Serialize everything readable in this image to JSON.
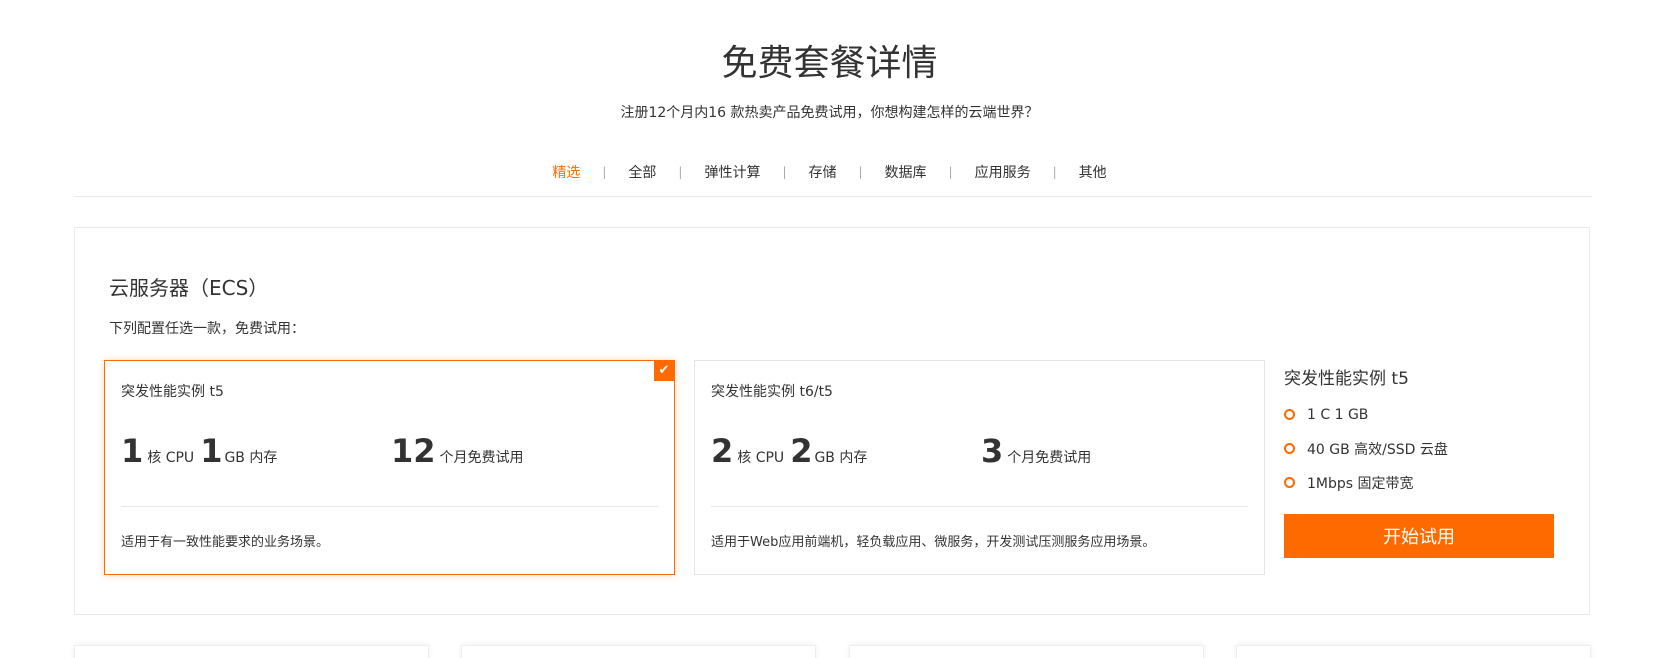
{
  "header": {
    "title": "免费套餐详情",
    "subtitle": "注册12个月内16 款热卖产品免费试用，你想构建怎样的云端世界？"
  },
  "tabs": [
    {
      "label": "精选",
      "active": true
    },
    {
      "label": "全部"
    },
    {
      "label": "弹性计算"
    },
    {
      "label": "存储"
    },
    {
      "label": "数据库"
    },
    {
      "label": "应用服务"
    },
    {
      "label": "其他"
    }
  ],
  "tab_separator": "|",
  "colors": {
    "accent": "#ff6a00",
    "border": "#eaeaea",
    "text": "#333333"
  },
  "product": {
    "title": "云服务器（ECS）",
    "description": "下列配置任选一款，免费试用：",
    "options": [
      {
        "name": "突发性能实例 t5",
        "cpu_value": "1",
        "cpu_unit": "核 CPU",
        "mem_value": "1",
        "mem_unit": "GB 内存",
        "trial_value": "12",
        "trial_unit": "个月免费试用",
        "note": "适用于有一致性能要求的业务场景。",
        "selected": true,
        "check_icon": "check-icon"
      },
      {
        "name": "突发性能实例 t6/t5",
        "cpu_value": "2",
        "cpu_unit": "核 CPU",
        "mem_value": "2",
        "mem_unit": "GB 内存",
        "trial_value": "3",
        "trial_unit": "个月免费试用",
        "note": "适用于Web应用前端机，轻负载应用、微服务，开发测试压测服务应用场景。",
        "selected": false
      }
    ],
    "summary": {
      "title": "突发性能实例 t5",
      "features": [
        "1 C 1 GB",
        "40 GB 高效/SSD 云盘",
        "1Mbps 固定带宽"
      ],
      "button_label": "开始试用"
    }
  }
}
